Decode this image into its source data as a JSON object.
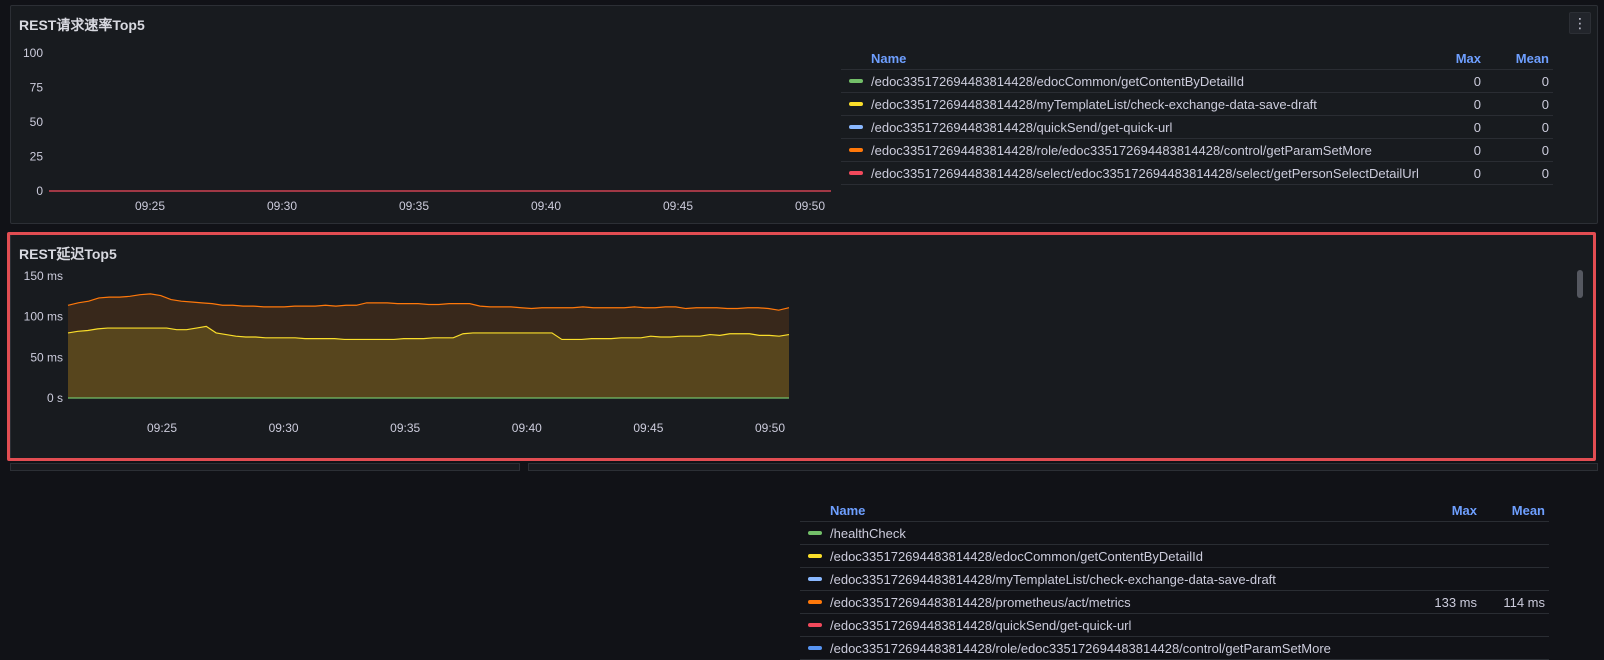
{
  "panels": [
    {
      "title": "REST请求速率Top5",
      "legend": {
        "headers": {
          "name": "Name",
          "max": "Max",
          "mean": "Mean"
        },
        "rows": [
          {
            "name": "/edoc335172694483814428/edocCommon/getContentByDetailId",
            "color": "#73bf69",
            "max": "0",
            "mean": "0"
          },
          {
            "name": "/edoc335172694483814428/myTemplateList/check-exchange-data-save-draft",
            "color": "#fade2a",
            "max": "0",
            "mean": "0"
          },
          {
            "name": "/edoc335172694483814428/quickSend/get-quick-url",
            "color": "#8ab8ff",
            "max": "0",
            "mean": "0"
          },
          {
            "name": "/edoc335172694483814428/role/edoc335172694483814428/control/getParamSetMore",
            "color": "#ff780a",
            "max": "0",
            "mean": "0"
          },
          {
            "name": "/edoc335172694483814428/select/edoc335172694483814428/select/getPersonSelectDetailUrl",
            "color": "#f2495c",
            "max": "0",
            "mean": "0"
          }
        ]
      }
    },
    {
      "title": "REST延迟Top5",
      "legend": {
        "headers": {
          "name": "Name",
          "max": "Max",
          "mean": "Mean"
        },
        "rows": [
          {
            "name": "/healthCheck",
            "color": "#73bf69",
            "max": "",
            "mean": ""
          },
          {
            "name": "/edoc335172694483814428/edocCommon/getContentByDetailId",
            "color": "#fade2a",
            "max": "",
            "mean": ""
          },
          {
            "name": "/edoc335172694483814428/myTemplateList/check-exchange-data-save-draft",
            "color": "#8ab8ff",
            "max": "",
            "mean": ""
          },
          {
            "name": "/edoc335172694483814428/prometheus/act/metrics",
            "color": "#ff780a",
            "max": "133 ms",
            "mean": "114 ms"
          },
          {
            "name": "/edoc335172694483814428/quickSend/get-quick-url",
            "color": "#f2495c",
            "max": "",
            "mean": ""
          },
          {
            "name": "/edoc335172694483814428/role/edoc335172694483814428/control/getParamSetMore",
            "color": "#5794f2",
            "max": "",
            "mean": ""
          }
        ]
      }
    }
  ],
  "menu_icon": "kebab-menu-icon",
  "chart_data": [
    {
      "type": "line",
      "x_ticks": [
        "09:25",
        "09:30",
        "09:35",
        "09:40",
        "09:45",
        "09:50"
      ],
      "y_ticks": [
        "0",
        "25",
        "50",
        "75",
        "100"
      ],
      "ylim": [
        0,
        100
      ],
      "series": [
        {
          "name": "/edoc335172694483814428/select/edoc335172694483814428/select/getPersonSelectDetailUrl",
          "color": "#f2495c",
          "values": [
            0,
            0
          ]
        }
      ]
    },
    {
      "type": "area",
      "x_ticks": [
        "09:25",
        "09:30",
        "09:35",
        "09:40",
        "09:45",
        "09:50"
      ],
      "y_ticks": [
        "0 s",
        "50 ms",
        "100 ms",
        "150 ms"
      ],
      "ylim": [
        0,
        150
      ],
      "x_range": [
        0,
        30
      ],
      "series": [
        {
          "name": "/edoc335172694483814428/prometheus/act/metrics",
          "color": "#ff780a",
          "values": [
            114,
            117,
            119,
            123,
            124,
            124,
            125,
            127,
            128,
            126,
            121,
            119,
            118,
            117,
            116,
            114,
            114,
            113,
            113,
            112,
            112,
            112,
            113,
            113,
            113,
            114,
            113,
            114,
            114,
            117,
            117,
            117,
            116,
            116,
            116,
            115,
            115,
            116,
            116,
            116,
            113,
            112,
            112,
            112,
            111,
            110,
            111,
            111,
            111,
            111,
            112,
            111,
            111,
            111,
            111,
            112,
            111,
            111,
            112,
            112,
            110,
            111,
            111,
            111,
            110,
            110,
            111,
            111,
            110,
            108,
            111
          ]
        },
        {
          "name": "/edoc335172694483814428/edocCommon/getContentByDetailId",
          "color": "#fade2a",
          "values": [
            80,
            82,
            83,
            85,
            86,
            86,
            86,
            86,
            86,
            86,
            86,
            84,
            84,
            86,
            88,
            80,
            78,
            76,
            75,
            75,
            74,
            74,
            74,
            74,
            73,
            73,
            73,
            73,
            72,
            72,
            72,
            72,
            72,
            72,
            73,
            73,
            73,
            74,
            74,
            74,
            79,
            80,
            80,
            80,
            80,
            80,
            80,
            80,
            80,
            80,
            72,
            72,
            72,
            73,
            73,
            73,
            74,
            74,
            74,
            76,
            75,
            75,
            76,
            76,
            76,
            78,
            77,
            79,
            79,
            79,
            77,
            77,
            76,
            78
          ]
        },
        {
          "name": "/healthCheck",
          "color": "#73bf69",
          "values": [
            0,
            0
          ]
        }
      ]
    }
  ]
}
